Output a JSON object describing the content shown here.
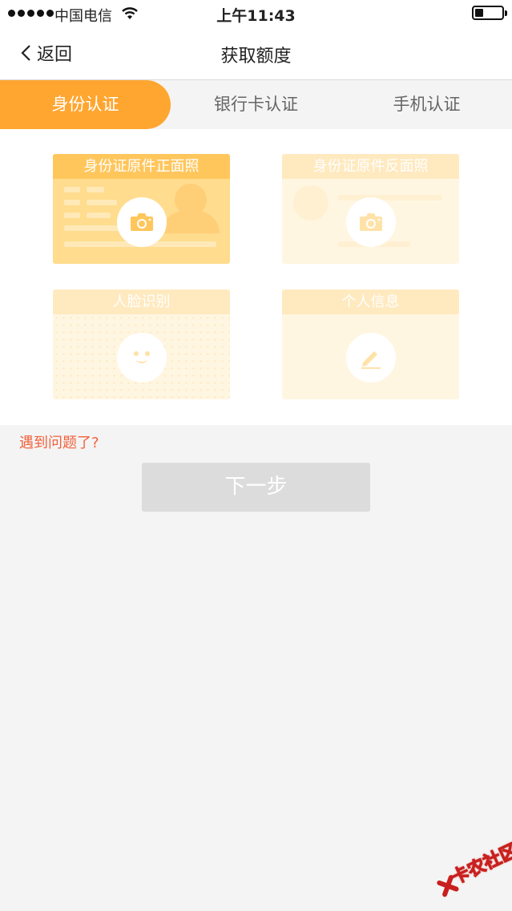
{
  "status_bar": {
    "carrier": "中国电信",
    "time": "上午11:43"
  },
  "nav": {
    "back_label": "返回",
    "title": "获取额度"
  },
  "tabs": [
    {
      "label": "身份认证",
      "active": true
    },
    {
      "label": "银行卡认证",
      "active": false
    },
    {
      "label": "手机认证",
      "active": false
    }
  ],
  "cards": [
    {
      "label": "身份证原件正面照",
      "icon": "camera-icon"
    },
    {
      "label": "身份证原件反面照",
      "icon": "camera-icon"
    },
    {
      "label": "人脸识别",
      "icon": "face-icon"
    },
    {
      "label": "个人信息",
      "icon": "pencil-icon"
    }
  ],
  "help_link": "遇到问题了?",
  "next_button": "下一步",
  "watermark": "卡农社区",
  "colors": {
    "accent": "#ffa630",
    "help": "#f2613c",
    "disabled": "#dcdcdc"
  }
}
